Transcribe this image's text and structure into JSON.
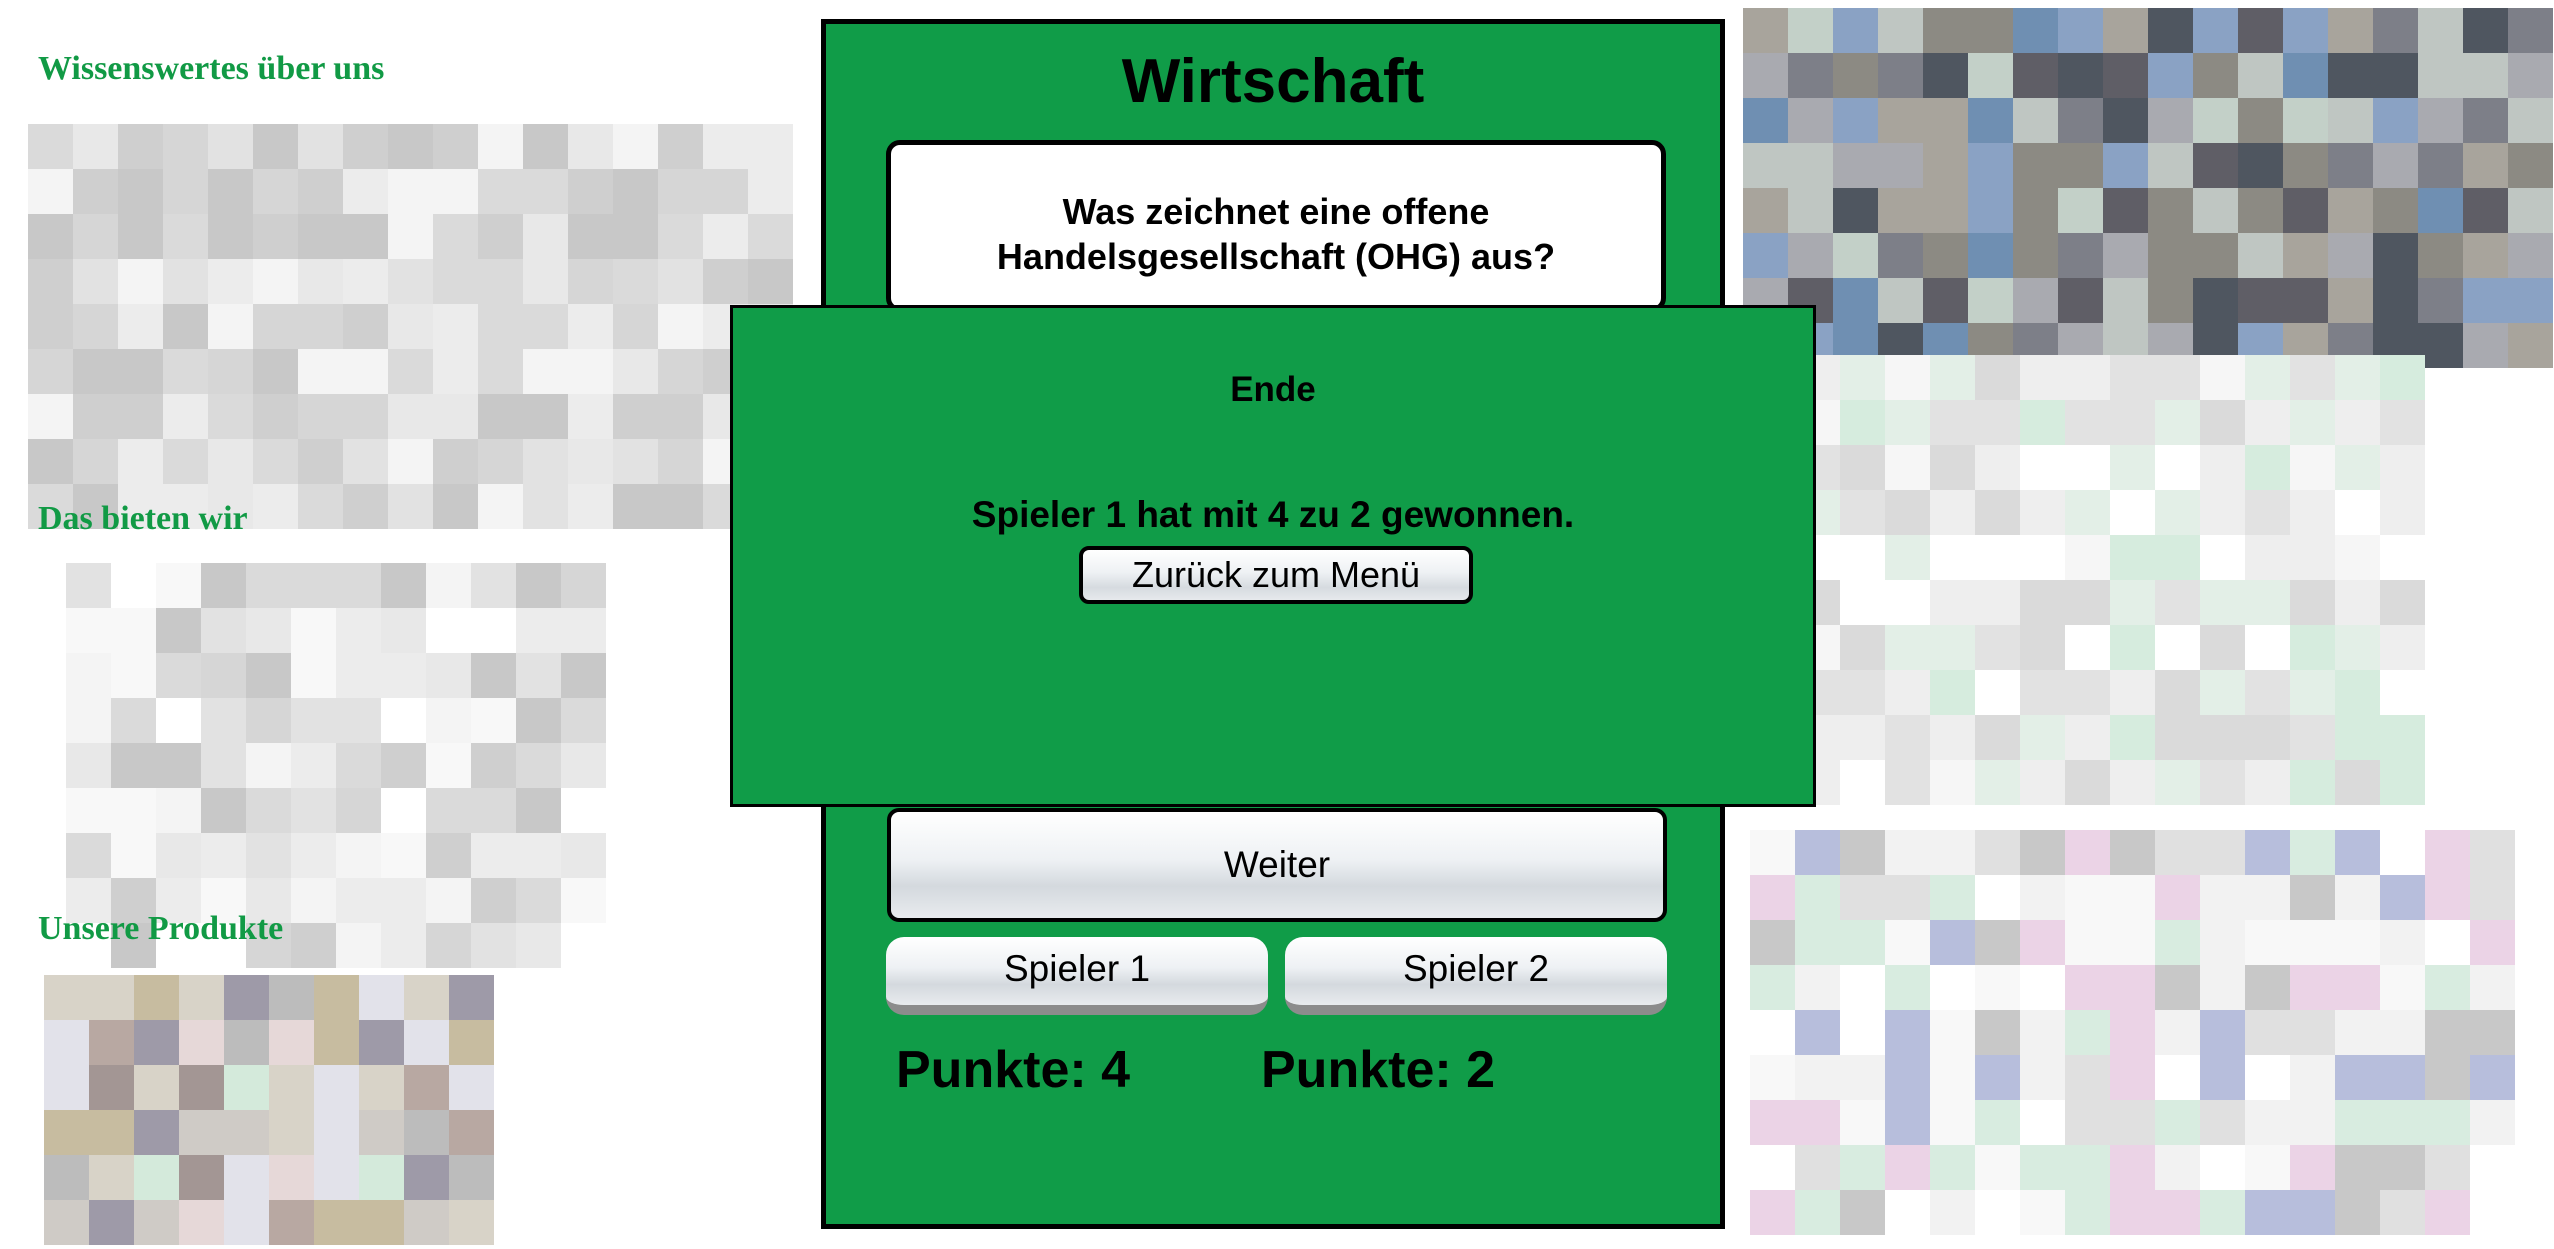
{
  "sidebar_left": {
    "headings": [
      "Wissenswertes über uns",
      "Das bieten wir",
      "Unsere Produkte"
    ]
  },
  "game": {
    "title": "Wirtschaft",
    "question_line1": "Was zeichnet eine offene",
    "question_line2": "Handelsgesellschaft (OHG) aus?",
    "next_label": "Weiter",
    "player1_label": "Spieler 1",
    "player2_label": "Spieler 2",
    "score_p1": "Punkte: 4",
    "score_p2": "Punkte: 2"
  },
  "modal": {
    "title": "Ende",
    "message": "Spieler 1 hat mit 4 zu 2 gewonnen.",
    "menu_button_label": "Zurück zum Menü"
  },
  "colors": {
    "game_green": "#109c48",
    "heading_green": "#119a45"
  }
}
